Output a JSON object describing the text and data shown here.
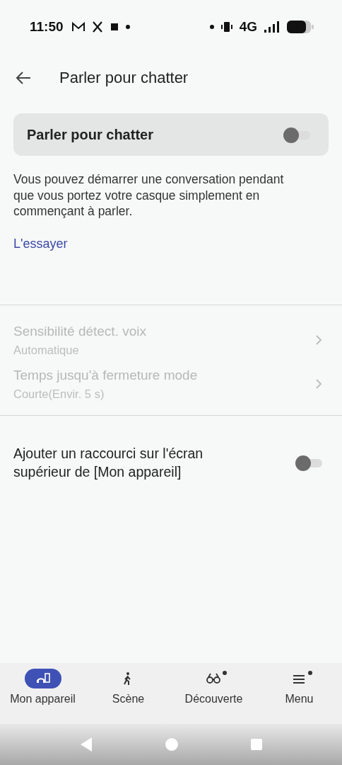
{
  "status_bar": {
    "time": "11:50",
    "network": "4G"
  },
  "header": {
    "title": "Parler pour chatter"
  },
  "main_toggle": {
    "label": "Parler pour chatter",
    "on": false
  },
  "description": "Vous pouvez démarrer une conversation pendant que vous portez votre casque simplement en commençant à parler.",
  "link": "L'essayer",
  "settings": [
    {
      "title": "Sensibilité détect. voix",
      "value": "Automatique",
      "disabled": true
    },
    {
      "title": "Temps jusqu'à fermeture mode",
      "value": "Courte(Envir. 5 s)",
      "disabled": true
    }
  ],
  "shortcut_toggle": {
    "label": "Ajouter un raccourci sur l'écran supérieur de [Mon appareil]",
    "on": false
  },
  "bottom_nav": [
    {
      "label": "Mon appareil",
      "kind": "device",
      "selected": true,
      "badge": false
    },
    {
      "label": "Scène",
      "kind": "walk",
      "selected": false,
      "badge": false
    },
    {
      "label": "Découverte",
      "kind": "binoculars",
      "selected": false,
      "badge": true
    },
    {
      "label": "Menu",
      "kind": "menu",
      "selected": false,
      "badge": true
    }
  ]
}
